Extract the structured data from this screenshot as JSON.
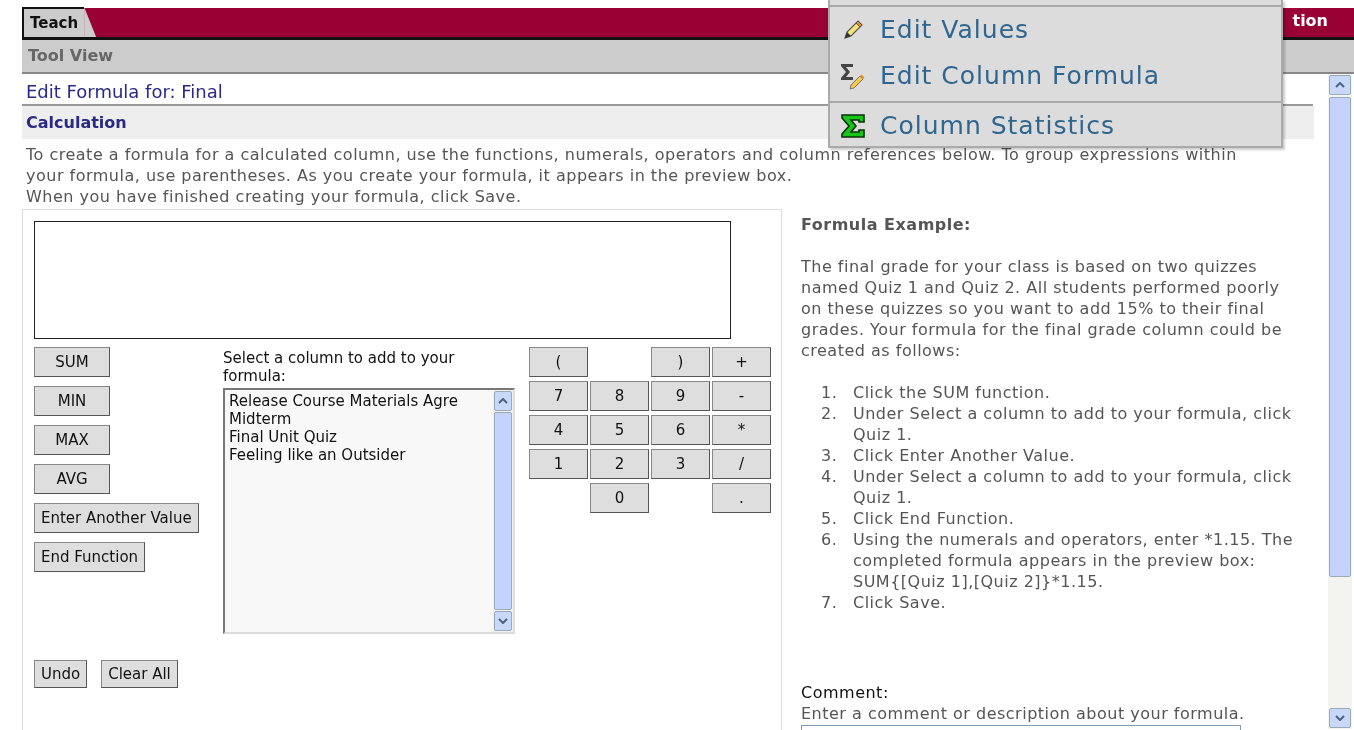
{
  "tabs": [
    {
      "label": "Teach",
      "selected": true
    }
  ],
  "tab_bar_right_text": "tion",
  "tool_view": "Tool View",
  "heading": "Edit Formula for: Final",
  "section": "Calculation",
  "instructions": [
    "To create a formula for a calculated column, use the functions, numerals, operators and column references below. To group expressions within your formula, use parentheses. As you create your formula, it appears in the preview box.",
    "When you have finished creating your formula, click Save."
  ],
  "functions": [
    {
      "label": "SUM",
      "kind": "fixed"
    },
    {
      "label": "MIN",
      "kind": "fixed"
    },
    {
      "label": "MAX",
      "kind": "fixed"
    },
    {
      "label": "AVG",
      "kind": "fixed"
    },
    {
      "label": "Enter Another Value",
      "kind": "wide"
    },
    {
      "label": "End Function",
      "kind": "wide"
    }
  ],
  "column_picker": {
    "label": "Select a column to add to your formula:",
    "items": [
      {
        "label": "Release Course Materials Agre",
        "selected": false
      },
      {
        "label": "Midterm",
        "selected": false
      },
      {
        "label": "Final Unit Quiz",
        "selected": false
      },
      {
        "label": "Feeling like an Outsider",
        "selected": false
      }
    ]
  },
  "keypad": [
    [
      {
        "kind": "key",
        "label": "("
      },
      {
        "kind": "blank"
      },
      {
        "kind": "key",
        "label": ")"
      },
      {
        "kind": "key",
        "label": "+"
      }
    ],
    [
      {
        "kind": "key",
        "label": "7"
      },
      {
        "kind": "key",
        "label": "8"
      },
      {
        "kind": "key",
        "label": "9"
      },
      {
        "kind": "key",
        "label": "-"
      }
    ],
    [
      {
        "kind": "key",
        "label": "4"
      },
      {
        "kind": "key",
        "label": "5"
      },
      {
        "kind": "key",
        "label": "6"
      },
      {
        "kind": "key",
        "label": "*"
      }
    ],
    [
      {
        "kind": "key",
        "label": "1"
      },
      {
        "kind": "key",
        "label": "2"
      },
      {
        "kind": "key",
        "label": "3"
      },
      {
        "kind": "key",
        "label": "/"
      }
    ],
    [
      {
        "kind": "blank"
      },
      {
        "kind": "key",
        "label": "0"
      },
      {
        "kind": "blank"
      },
      {
        "kind": "key",
        "label": "."
      }
    ]
  ],
  "actions": [
    "Undo",
    "Clear All"
  ],
  "example": {
    "title": "Formula Example:",
    "intro": "The final grade for your class is based on two quizzes named Quiz 1 and Quiz 2. All students performed poorly on these quizzes so you want to add 15% to their final grades. Your formula for the final grade column could be created as follows:",
    "steps": [
      {
        "number": "1.",
        "text": "Click the SUM function."
      },
      {
        "number": "2.",
        "text": "Under Select a column to add to your formula, click Quiz 1."
      },
      {
        "number": "3.",
        "text": "Click Enter Another Value."
      },
      {
        "number": "4.",
        "text": "Under Select a column to add to your formula, click Quiz 1."
      },
      {
        "number": "5.",
        "text": "Click End Function."
      },
      {
        "number": "6.",
        "text": "Using the numerals and operators, enter *1.15. The completed formula appears in the preview box: SUM{[Quiz 1],[Quiz 2]}*1.15."
      },
      {
        "number": "7.",
        "text": "Click Save."
      }
    ]
  },
  "comment": {
    "label": "Comment:",
    "hint": "Enter a comment or description about your formula."
  },
  "menu": {
    "items": [
      {
        "label": "Edit Values",
        "kind": "pencil"
      },
      {
        "label": "Edit Column Formula",
        "kind": "sigma-pencil"
      },
      {
        "label": "Column Statistics",
        "kind": "sigma"
      }
    ]
  }
}
